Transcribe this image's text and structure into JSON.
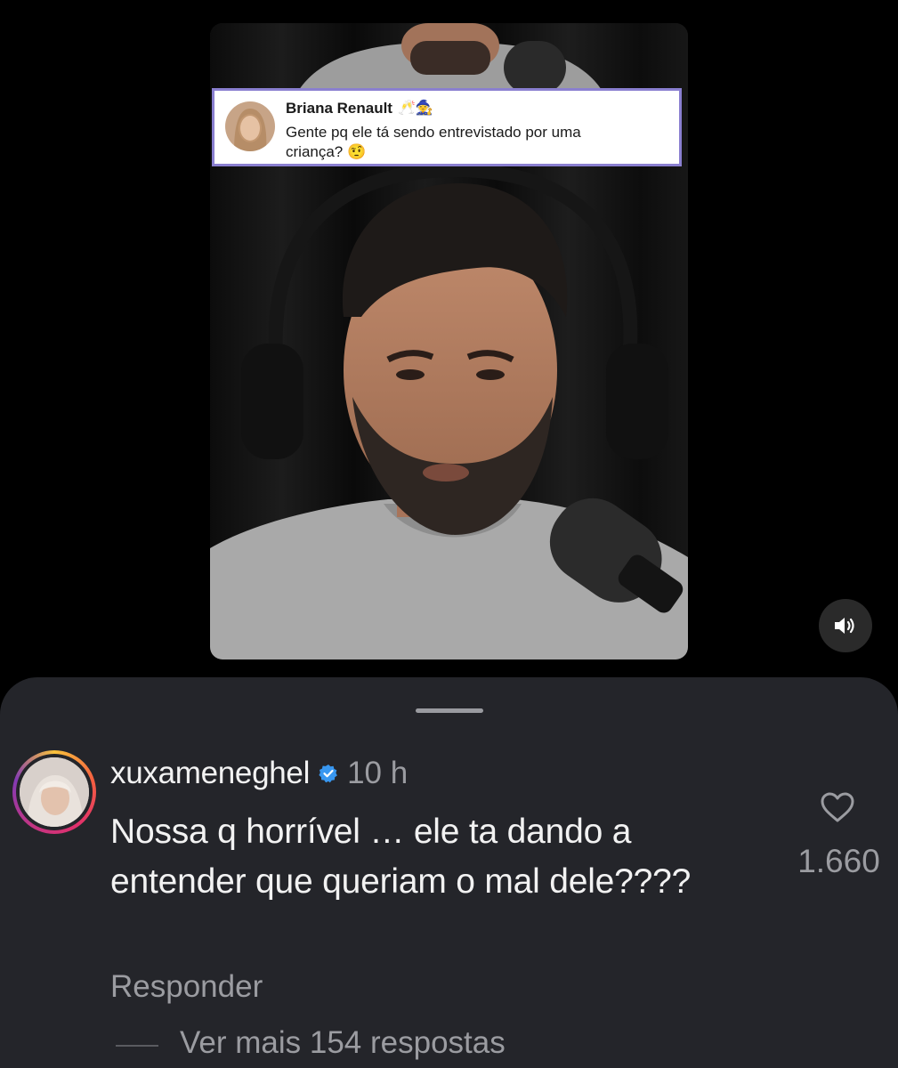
{
  "video": {
    "overlay_comment": {
      "author": "Briana Renault",
      "author_emojis": "🥂🧙",
      "text": "Gente pq ele tá sendo entrevistado por uma criança? 🤨"
    },
    "sound_icon": "speaker-volume-icon"
  },
  "comment": {
    "username": "xuxameneghel",
    "verified_icon": "verified-badge-icon",
    "time": "10 h",
    "text": "Nossa q horrível … ele ta dando a entender que queriam o mal dele????",
    "like_icon": "heart-outline-icon",
    "likes": "1.660",
    "reply_label": "Responder",
    "more_replies_label": "Ver mais 154 respostas"
  },
  "colors": {
    "background": "#000000",
    "sheet": "#24252a",
    "primary_text": "#f2f2f2",
    "secondary_text": "#9b9ca1",
    "verified_blue": "#3897f0",
    "overlay_border": "#8a7fd0"
  }
}
